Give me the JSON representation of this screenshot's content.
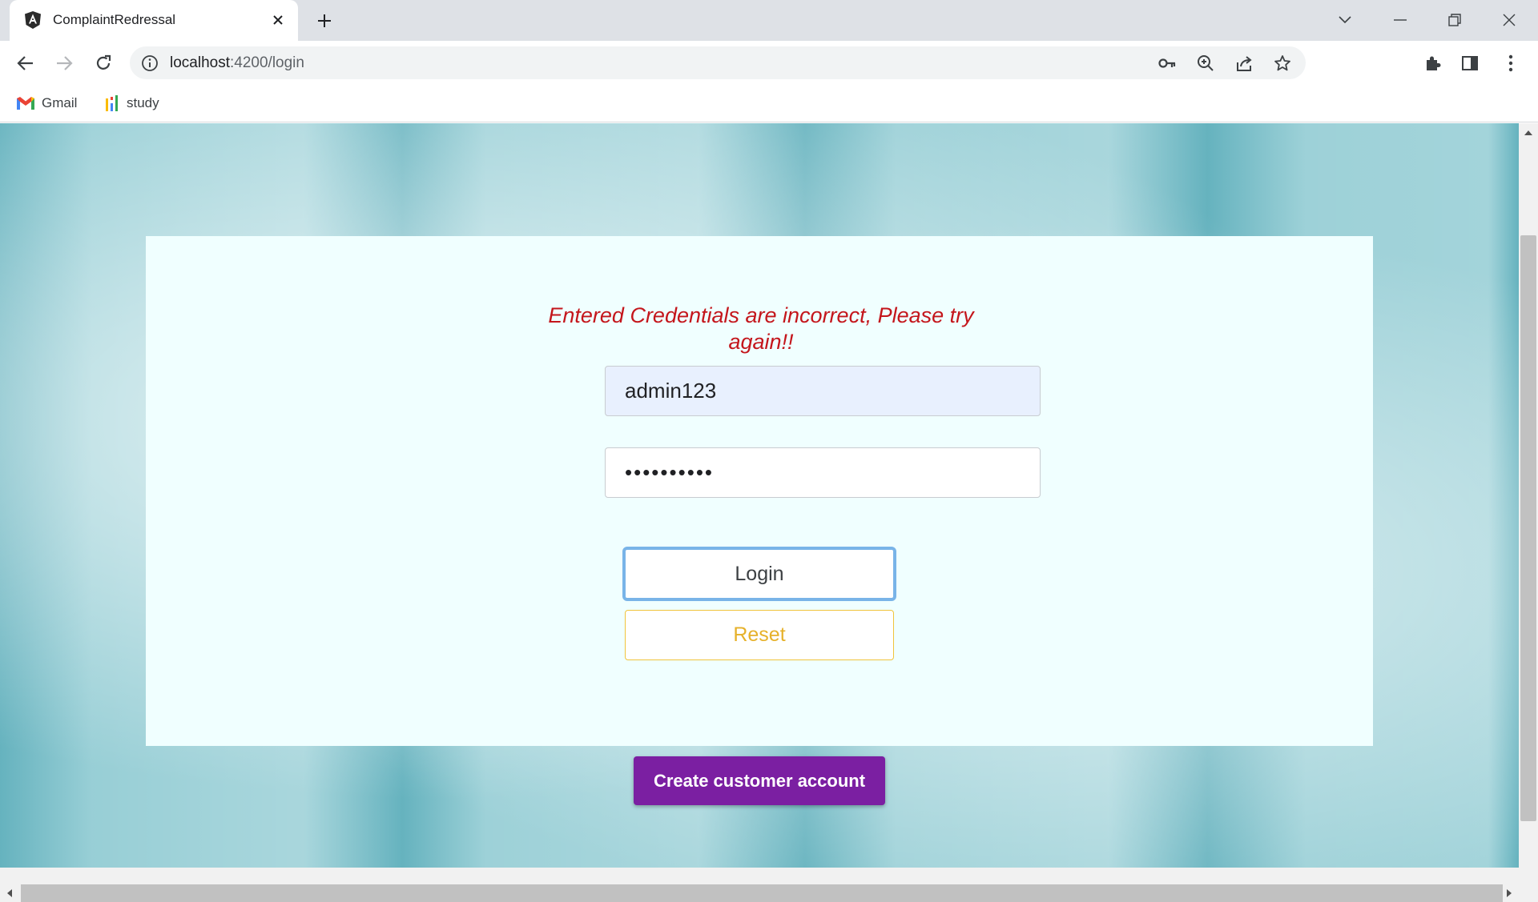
{
  "browser": {
    "tab_title": "ComplaintRedressal",
    "url_host": "localhost",
    "url_path": ":4200/login",
    "bookmarks": [
      {
        "label": "Gmail",
        "icon": "gmail-icon"
      },
      {
        "label": "study",
        "icon": "bars-icon"
      }
    ]
  },
  "login": {
    "error_message": "Entered Credentials are incorrect, Please try again!!",
    "username_value": "admin123",
    "password_value": "••••••••••",
    "login_label": "Login",
    "reset_label": "Reset",
    "create_account_label": "Create customer account"
  },
  "colors": {
    "error": "#c4161c",
    "login_border": "#79b4e8",
    "reset": "#e6b12a",
    "create_account": "#7b1fa2",
    "card_bg": "#f0ffff"
  }
}
